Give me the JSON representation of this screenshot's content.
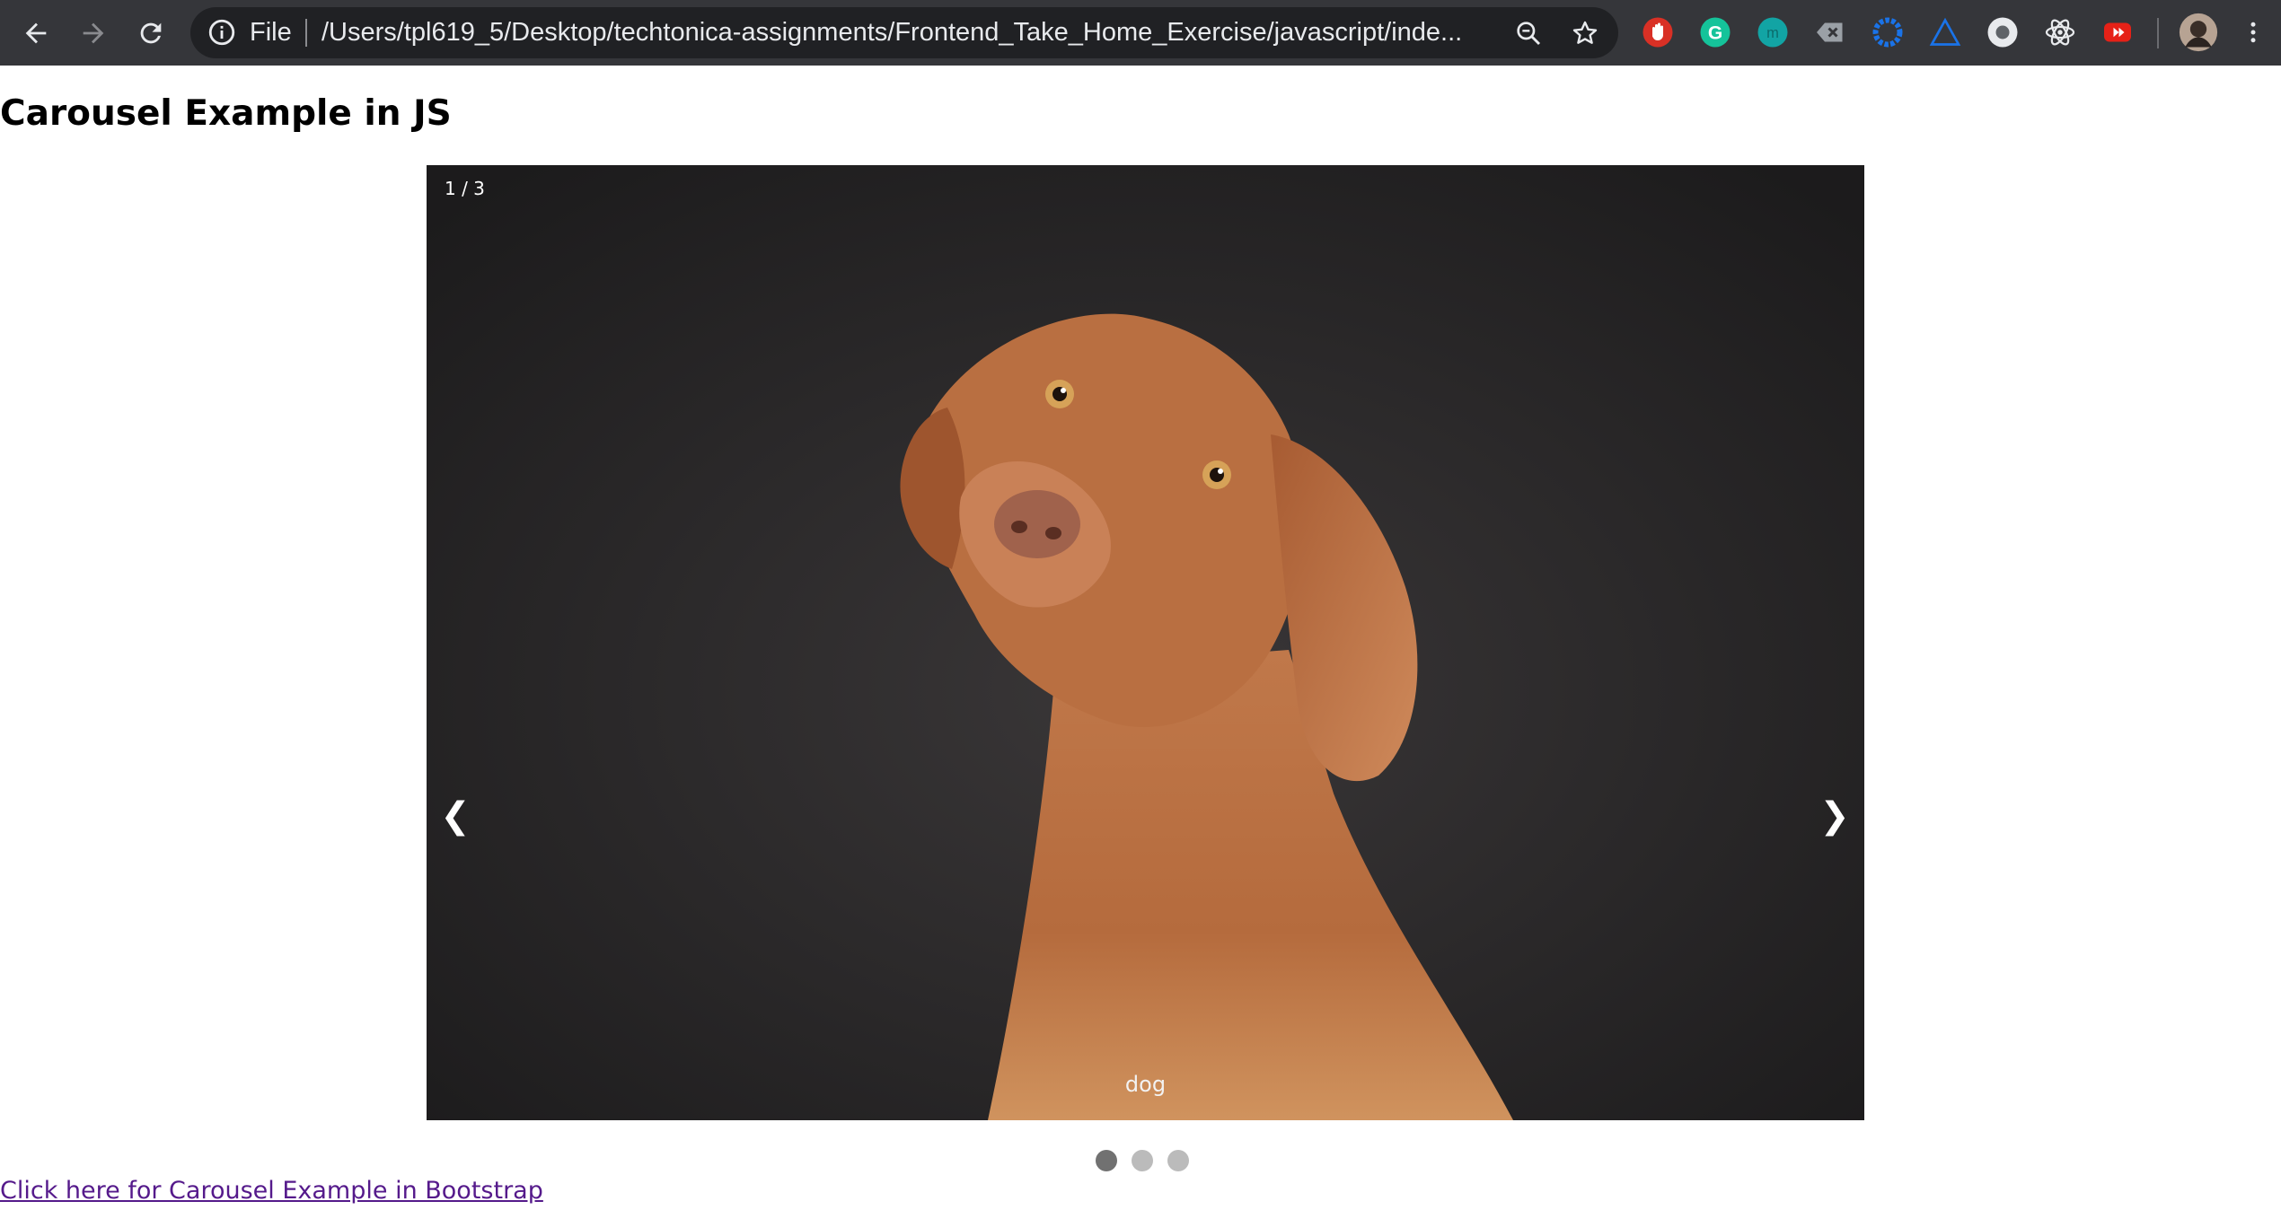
{
  "browser": {
    "omnibox": {
      "scheme_label": "File",
      "url": "/Users/tpl619_5/Desktop/techtonica-assignments/Frontend_Take_Home_Exercise/javascript/inde..."
    },
    "toolbar_color": "#35363a",
    "omnibox_color": "#202124",
    "extensions": [
      {
        "name": "stop-hand-extension",
        "color": "#d93025"
      },
      {
        "name": "grammarly-extension",
        "color": "#15c39a"
      },
      {
        "name": "mercury-extension",
        "color": "#12a4a4"
      },
      {
        "name": "clear-cache-extension",
        "color": "#9aa0a6"
      },
      {
        "name": "blue-ring-extension",
        "color": "#1a73e8"
      },
      {
        "name": "triangle-extension",
        "color": "#1a73e8"
      },
      {
        "name": "round-gray-extension",
        "color": "#e8eaed"
      },
      {
        "name": "react-devtools-extension",
        "color": "#e8eaed"
      },
      {
        "name": "youtube-extension",
        "color": "#e62117"
      }
    ]
  },
  "page": {
    "title": "Carousel Example in JS",
    "carousel": {
      "counter": "1 / 3",
      "prev_label": "❮",
      "next_label": "❯",
      "caption": "dog",
      "slide_count": 3,
      "active_slide": 1
    },
    "link_text": "Click here for Carousel Example in Bootstrap",
    "link_color": "#551a8b"
  }
}
